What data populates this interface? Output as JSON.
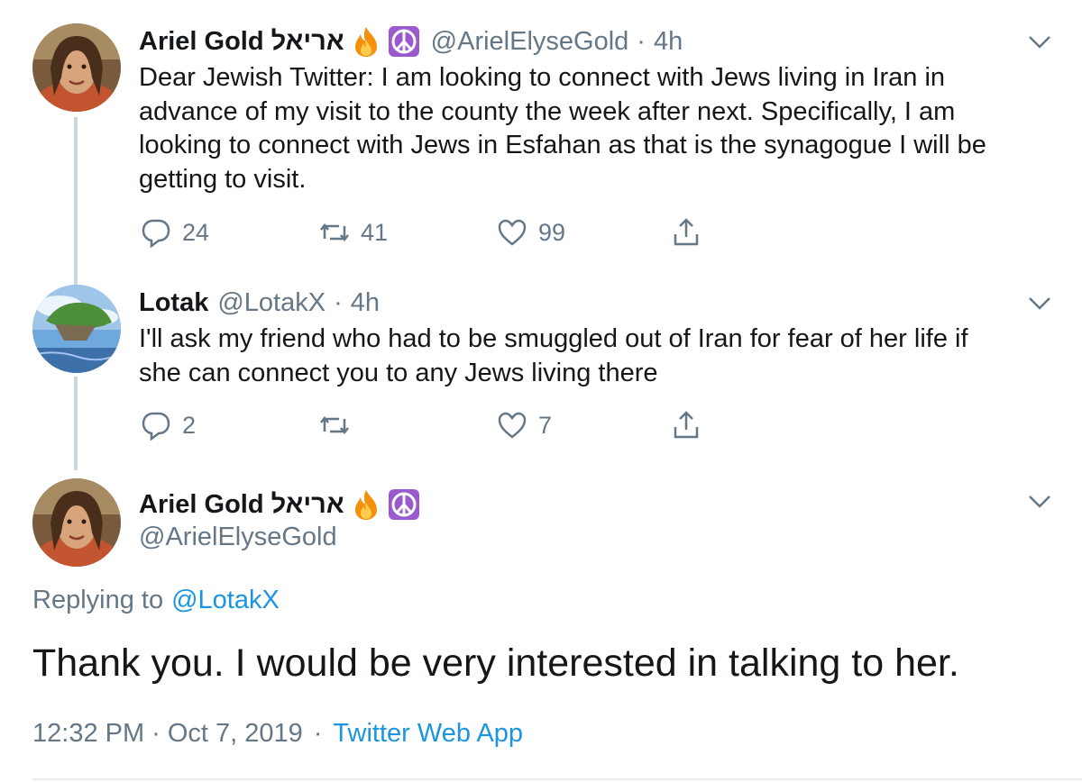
{
  "tweet1": {
    "name": "Ariel Gold אריאל",
    "handle": "@ArielElyseGold",
    "sep": "·",
    "time": "4h",
    "text_lines": [
      "Dear Jewish Twitter: I am looking to connect with Jews living in Iran in",
      "advance of my visit to the county the week after next. Specifically, I am",
      "looking to connect with Jews in Esfahan as that is the synagogue I will be",
      "getting to visit."
    ],
    "replies": "24",
    "retweets": "41",
    "likes": "99"
  },
  "tweet2": {
    "name": "Lotak",
    "handle": "@LotakX",
    "sep": "·",
    "time": "4h",
    "text_lines": [
      "I'll ask my friend who had to be smuggled out of Iran for fear of her life if",
      "she can connect you to any Jews living there"
    ],
    "replies": "2",
    "retweets": "",
    "likes": "7"
  },
  "tweet3": {
    "name": "Ariel Gold אריאל",
    "handle": "@ArielElyseGold",
    "replying_prefix": "Replying to",
    "replying_to": "@LotakX",
    "text": "Thank you. I would be very interested in talking to her.",
    "time": "12:32 PM",
    "date": "Oct 7, 2019",
    "sep": "·",
    "source": "Twitter Web App"
  },
  "icons": [
    "fire-emoji",
    "peace-symbol-emoji",
    "reply-icon",
    "retweet-icon",
    "like-icon",
    "share-icon",
    "chevron-down-icon"
  ],
  "colors": {
    "text": "#14171a",
    "muted": "#657786",
    "link": "#1b95e0",
    "thread_line": "#ccd6dd",
    "peace_bg": "#9b59d0",
    "fire": "#f4900c"
  }
}
